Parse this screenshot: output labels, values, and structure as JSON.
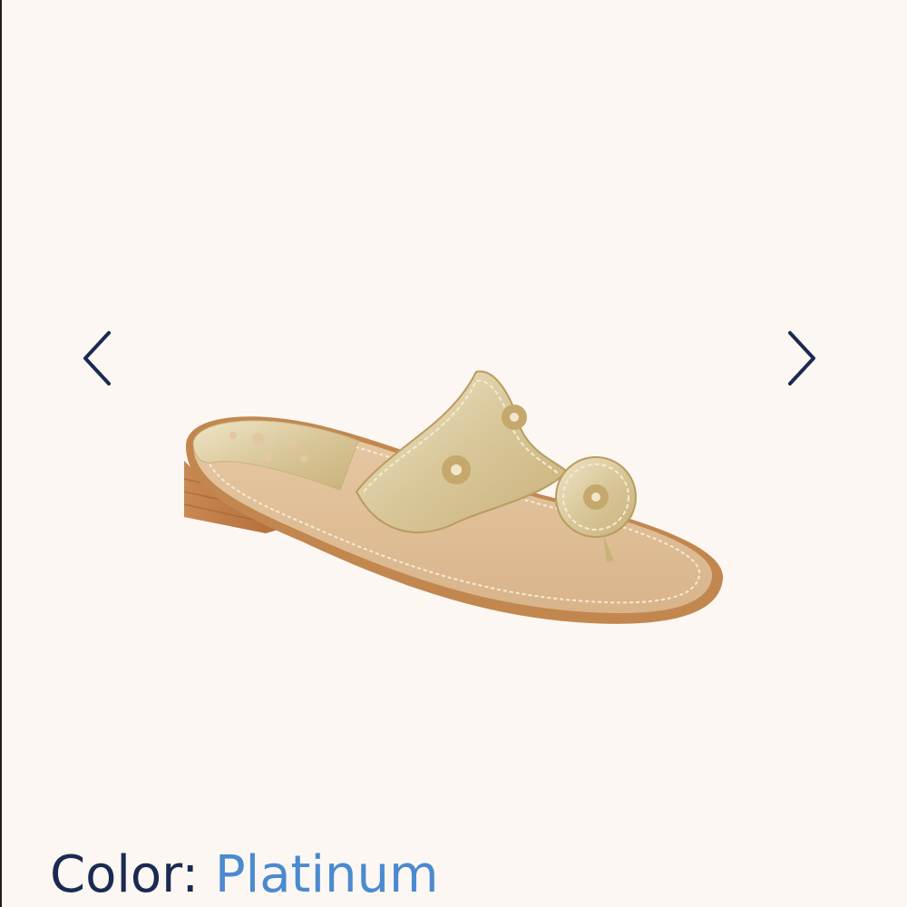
{
  "icons": {
    "prev": "chevron-left-icon",
    "next": "chevron-right-icon"
  },
  "product": {
    "image": "gold-platinum-leather-thong-sandal"
  },
  "color_selector": {
    "label": "Color:",
    "value": "Platinum"
  },
  "colors": {
    "background": "#fcf7f3",
    "arrow": "#1a2a52",
    "label": "#1a2a52",
    "value": "#4b8ad0"
  }
}
